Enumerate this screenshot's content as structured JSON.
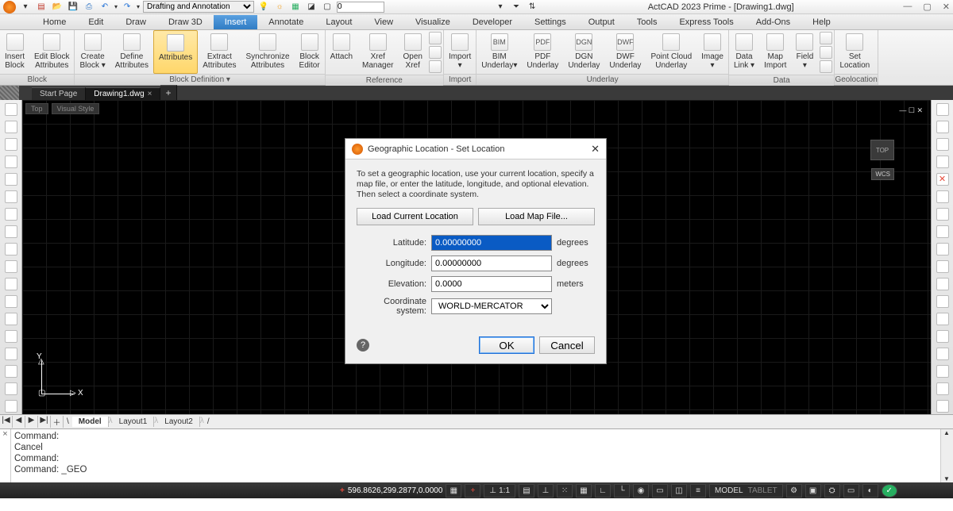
{
  "app": {
    "title": "ActCAD 2023 Prime - [Drawing1.dwg]"
  },
  "qat": {
    "workspace": "Drafting and Annotation",
    "numbox": "0"
  },
  "menu": {
    "items": [
      "Home",
      "Edit",
      "Draw",
      "Draw 3D",
      "Insert",
      "Annotate",
      "Layout",
      "View",
      "Visualize",
      "Developer",
      "Settings",
      "Output",
      "Tools",
      "Express Tools",
      "Add-Ons",
      "Help"
    ],
    "active": "Insert"
  },
  "ribbon": {
    "panels": [
      {
        "label": "Block",
        "items": [
          {
            "name": "insert-block",
            "l1": "Insert",
            "l2": "Block"
          },
          {
            "name": "edit-block-attributes",
            "l1": "Edit Block",
            "l2": "Attributes"
          }
        ]
      },
      {
        "label": "Block Definition ▾",
        "items": [
          {
            "name": "create-block",
            "l1": "Create",
            "l2": "Block ▾"
          },
          {
            "name": "define-attributes",
            "l1": "Define",
            "l2": "Attributes"
          },
          {
            "name": "attributes",
            "l1": "Attributes",
            "l2": "",
            "highlight": true
          },
          {
            "name": "extract-attributes",
            "l1": "Extract",
            "l2": "Attributes"
          },
          {
            "name": "synchronize-attributes",
            "l1": "Synchronize",
            "l2": "Attributes"
          },
          {
            "name": "block-editor",
            "l1": "Block",
            "l2": "Editor"
          }
        ]
      },
      {
        "label": "Reference",
        "items": [
          {
            "name": "attach",
            "l1": "Attach",
            "l2": ""
          },
          {
            "name": "xref-manager",
            "l1": "Xref",
            "l2": "Manager"
          },
          {
            "name": "open-xref",
            "l1": "Open",
            "l2": "Xref"
          }
        ],
        "smallgrid": true
      },
      {
        "label": "Import",
        "items": [
          {
            "name": "import",
            "l1": "Import",
            "l2": "▾"
          }
        ]
      },
      {
        "label": "Underlay",
        "items": [
          {
            "name": "bim-underlay",
            "l1": "BIM",
            "l2": "Underlay▾",
            "badge": "BIM"
          },
          {
            "name": "pdf-underlay",
            "l1": "PDF",
            "l2": "Underlay",
            "badge": "PDF"
          },
          {
            "name": "dgn-underlay",
            "l1": "DGN",
            "l2": "Underlay",
            "badge": "DGN"
          },
          {
            "name": "dwf-underlay",
            "l1": "DWF",
            "l2": "Underlay",
            "badge": "DWF"
          },
          {
            "name": "point-cloud-underlay",
            "l1": "Point Cloud",
            "l2": "Underlay"
          },
          {
            "name": "image",
            "l1": "Image",
            "l2": "▾"
          }
        ]
      },
      {
        "label": "Data",
        "items": [
          {
            "name": "data-link",
            "l1": "Data",
            "l2": "Link ▾"
          },
          {
            "name": "map-import",
            "l1": "Map",
            "l2": "Import"
          },
          {
            "name": "field",
            "l1": "Field",
            "l2": "▾"
          }
        ],
        "smallgrid": true
      },
      {
        "label": "Geolocation",
        "items": [
          {
            "name": "set-location",
            "l1": "Set",
            "l2": "Location"
          }
        ]
      }
    ]
  },
  "doctabs": {
    "tabs": [
      "Start Page",
      "Drawing1.dwg"
    ],
    "active": "Drawing1.dwg"
  },
  "viewport": {
    "top": "Top",
    "vstyle": "Visual Style",
    "cube": "TOP",
    "wcs": "WCS",
    "axisY": "Y",
    "axisX": "X"
  },
  "dialog": {
    "title": "Geographic Location - Set Location",
    "description": "To set a geographic location, use your current location, specify a map file, or enter the latitude, longitude, and optional elevation. Then select a coordinate system.",
    "btn_load_current": "Load Current Location",
    "btn_load_map": "Load Map File...",
    "lat_label": "Latitude:",
    "lat_value": "0.00000000",
    "lon_label": "Longitude:",
    "lon_value": "0.00000000",
    "elev_label": "Elevation:",
    "elev_value": "0.0000",
    "cs_label": "Coordinate system:",
    "cs_value": "WORLD-MERCATOR",
    "unit_deg": "degrees",
    "unit_m": "meters",
    "ok": "OK",
    "cancel": "Cancel"
  },
  "layouts": {
    "tabs": [
      "Model",
      "Layout1",
      "Layout2"
    ],
    "active": "Model"
  },
  "command": {
    "lines": [
      "Command:",
      "Cancel",
      "Command:",
      "Command: _GEO"
    ]
  },
  "status": {
    "coords": "596.8626,299.2877,0.0000",
    "scale": "1:1",
    "model": "MODEL",
    "tablet": "TABLET"
  }
}
